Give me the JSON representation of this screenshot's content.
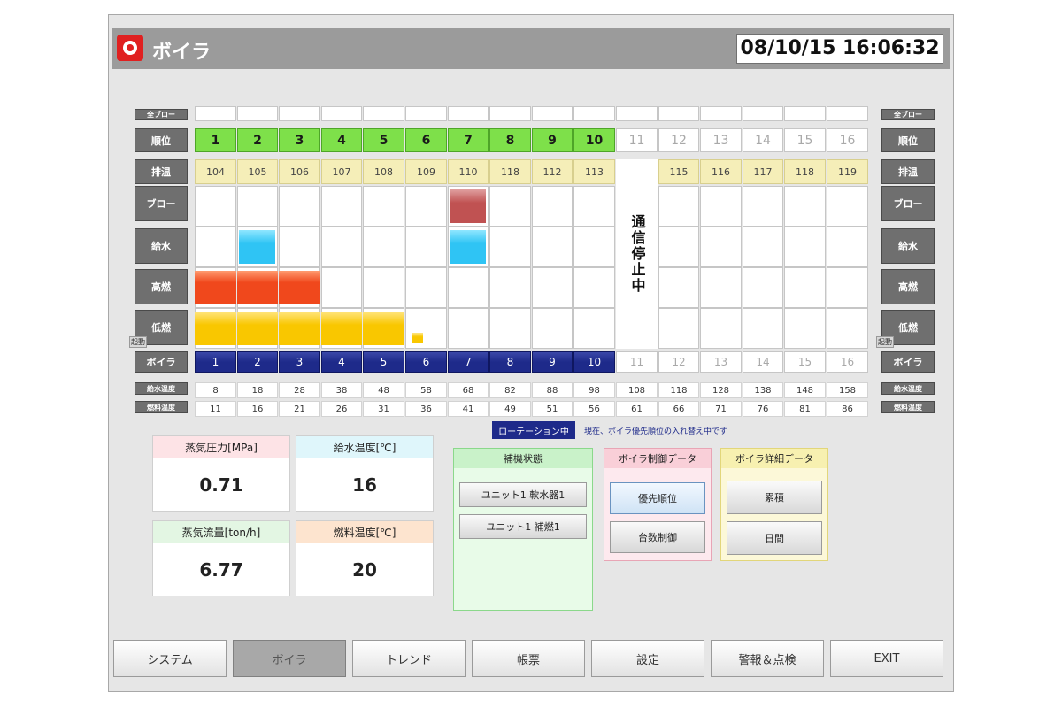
{
  "header": {
    "title": "ボイラ",
    "datetime": "08/10/15 16:06:32",
    "logo_icon": "boiler-logo-icon"
  },
  "grid": {
    "row_labels": {
      "blow_all": "全ブロー",
      "rank": "順位",
      "exhaust": "排温",
      "blow": "ブロー",
      "water_feed": "給水",
      "high_burn": "高燃",
      "low_burn": "低燃",
      "boiler": "ボイラ",
      "feed_water_temp": "給水温度",
      "fuel_temp": "燃料温度"
    },
    "side_mini": "起動",
    "comm_stop": "通信停止中",
    "rank": [
      "1",
      "2",
      "3",
      "4",
      "5",
      "6",
      "7",
      "8",
      "9",
      "10",
      "11",
      "12",
      "13",
      "14",
      "15",
      "16"
    ],
    "exhaust": [
      "104",
      "105",
      "106",
      "107",
      "108",
      "109",
      "110",
      "118",
      "112",
      "113",
      "",
      "115",
      "116",
      "117",
      "118",
      "119"
    ],
    "boiler": [
      "1",
      "2",
      "3",
      "4",
      "5",
      "6",
      "7",
      "8",
      "9",
      "10",
      "11",
      "12",
      "13",
      "14",
      "15",
      "16"
    ],
    "feed_water_temp": [
      "8",
      "18",
      "28",
      "38",
      "48",
      "58",
      "68",
      "82",
      "88",
      "98",
      "108",
      "118",
      "128",
      "138",
      "148",
      "158"
    ],
    "fuel_temp": [
      "11",
      "16",
      "21",
      "26",
      "31",
      "36",
      "41",
      "49",
      "51",
      "56",
      "61",
      "66",
      "71",
      "76",
      "81",
      "86"
    ],
    "blow_on": [
      7
    ],
    "water_on": [
      2,
      7
    ],
    "high_burn_on": [
      1,
      2,
      3
    ],
    "low_burn_on": [
      1,
      2,
      3,
      4,
      5
    ],
    "low_burn_partial": [
      6
    ],
    "active_count": 10,
    "colors": {
      "blow": "#c05252",
      "water": "#2fc4f4",
      "high": "#f0481c",
      "low": "#f9c700",
      "boiler": "#1e2a8a",
      "rank": "#7ee04a"
    }
  },
  "status": {
    "rotation": "ローテーション中",
    "rotation_note": "現在、ボイラ優先順位の入れ替え中です"
  },
  "measurements": {
    "steam_pressure": {
      "label": "蒸気圧力[MPa]",
      "value": "0.71",
      "color": "#fde3e6"
    },
    "feed_water_temp": {
      "label": "給水温度[℃]",
      "value": "16",
      "color": "#dff6fb"
    },
    "steam_flow": {
      "label": "蒸気流量[ton/h]",
      "value": "6.77",
      "color": "#e3f6e3"
    },
    "fuel_temp": {
      "label": "燃料温度[℃]",
      "value": "20",
      "color": "#fde4cf"
    }
  },
  "aux_panel": {
    "title": "補機状態",
    "buttons": [
      "ユニット1 軟水器1",
      "ユニット1 補燃1"
    ],
    "color": "#c9f2c9"
  },
  "control_panel": {
    "title": "ボイラ制御データ",
    "buttons": [
      "優先順位",
      "台数制御"
    ],
    "color": "#f9cfd8"
  },
  "detail_panel": {
    "title": "ボイラ詳細データ",
    "buttons": [
      "累積",
      "日間"
    ],
    "color": "#f7f0b0"
  },
  "nav": {
    "items": [
      "システム",
      "ボイラ",
      "トレンド",
      "帳票",
      "設定",
      "警報＆点検",
      "EXIT"
    ],
    "selected": "ボイラ"
  }
}
